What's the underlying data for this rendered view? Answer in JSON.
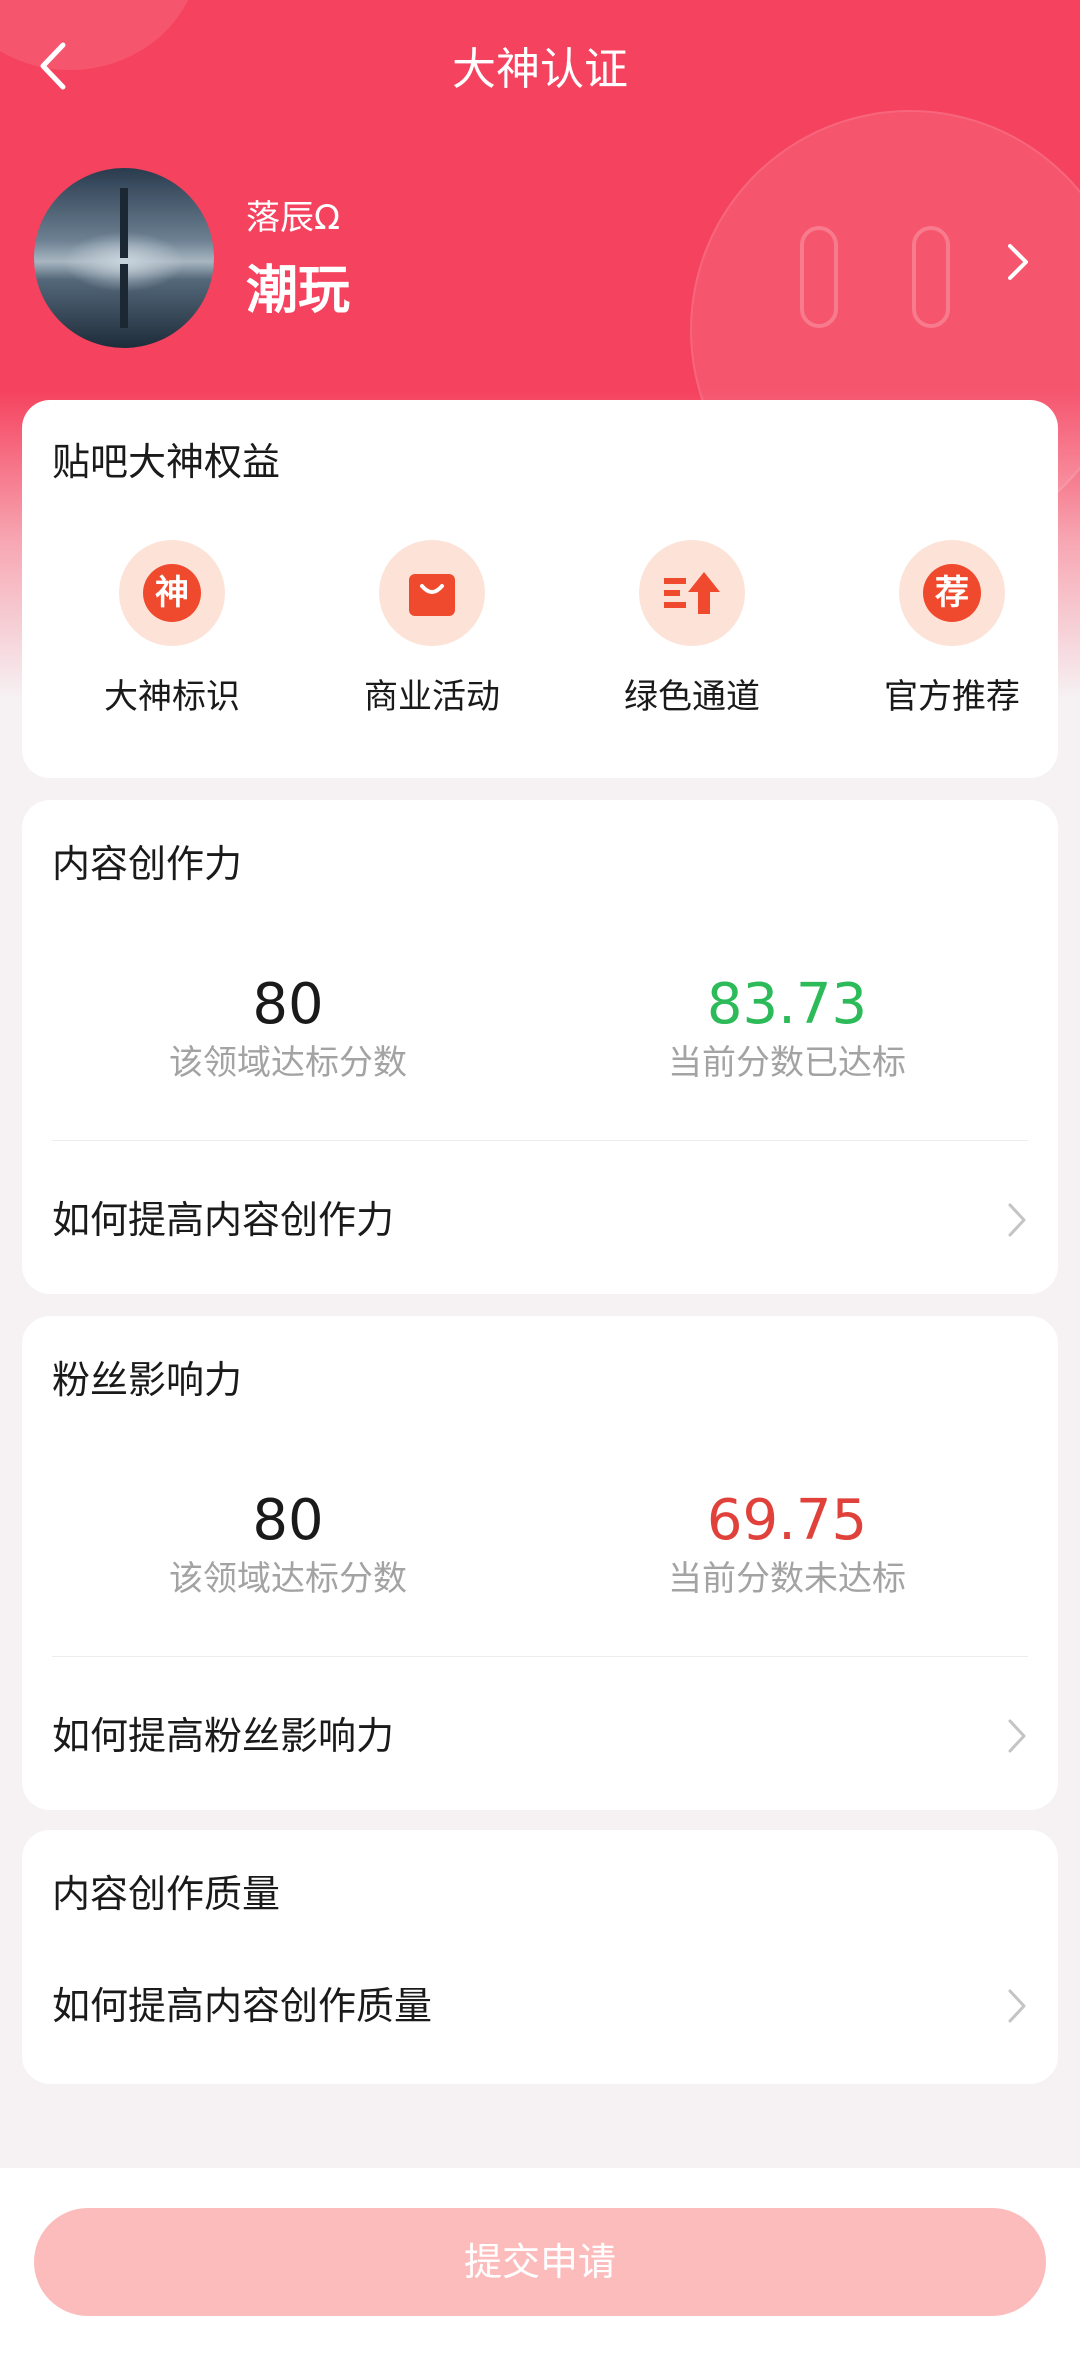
{
  "header": {
    "title": "大神认证"
  },
  "profile": {
    "nickname": "落辰Ω",
    "field": "潮玩"
  },
  "benefits": {
    "title": "贴吧大神权益",
    "items": [
      {
        "label": "大神标识",
        "glyph": "神",
        "icon": "badge-icon"
      },
      {
        "label": "商业活动",
        "glyph": "",
        "icon": "shopping-bag-icon"
      },
      {
        "label": "绿色通道",
        "glyph": "",
        "icon": "fast-track-icon"
      },
      {
        "label": "官方推荐",
        "glyph": "荐",
        "icon": "recommend-icon"
      }
    ]
  },
  "content_creation": {
    "title": "内容创作力",
    "target_score": "80",
    "target_label": "该领域达标分数",
    "current_score": "83.73",
    "current_label": "当前分数已达标",
    "current_color": "#2dbb5a",
    "link": "如何提高内容创作力"
  },
  "fan_influence": {
    "title": "粉丝影响力",
    "target_score": "80",
    "target_label": "该领域达标分数",
    "current_score": "69.75",
    "current_label": "当前分数未达标",
    "current_color": "#e0413a",
    "link": "如何提高粉丝影响力"
  },
  "content_quality": {
    "title": "内容创作质量",
    "link": "如何提高内容创作质量"
  },
  "submit": {
    "label": "提交申请"
  },
  "theme": {
    "primary": "#f5425e",
    "button_disabled": "#fdbcbc"
  }
}
